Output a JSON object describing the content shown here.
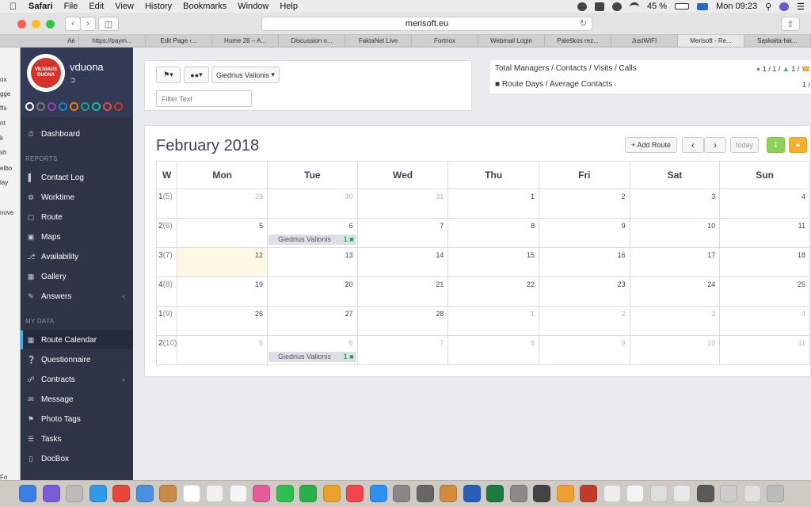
{
  "menubar": {
    "app": "Safari",
    "items": [
      "File",
      "Edit",
      "View",
      "History",
      "Bookmarks",
      "Window",
      "Help"
    ],
    "battery": "45 %",
    "clock": "Mon 09:23"
  },
  "browser": {
    "url": "merisoft.eu",
    "tabs": [
      "Aė",
      "https://paym...",
      "Edit Page ‹...",
      "Home 28 – A...",
      "Discussion o...",
      "FaktaNet Live",
      "Fortnox",
      "Webmail Login",
      "Paleškos rez...",
      "JustWIFI",
      "Merisoft - Re...",
      "Sąskaita-fak..."
    ],
    "active_tab": 10
  },
  "leftstrip": [
    "ox",
    "gge",
    "fts",
    "nt",
    "k",
    "sh",
    "elbo",
    "lay",
    "nove",
    "Fo"
  ],
  "sidebar": {
    "username": "vduona",
    "logo_text": "VILNIAUS DUONA",
    "swatches": [
      "#ffffff",
      "#7a7a7a",
      "#8e44ad",
      "#2980b9",
      "#e67e22",
      "#16a085",
      "#1abc9c",
      "#e74c3c",
      "#c0392b"
    ],
    "dashboard": "Dashboard",
    "section_reports": "REPORTS",
    "reports": [
      "Contact Log",
      "Worktime",
      "Route",
      "Maps",
      "Availability",
      "Gallery",
      "Answers"
    ],
    "section_mydata": "MY DATA",
    "mydata": [
      "Route Calendar",
      "Questionnaire",
      "Contracts",
      "Message",
      "Photo Tags",
      "Tasks",
      "DocBox"
    ]
  },
  "filters": {
    "user_select": "Giedrius Valionis",
    "filter_placeholder": "Filter Text"
  },
  "stats": {
    "row1_label": "Total Managers / Contacts / Visits / Calls",
    "row1_value_a": "1",
    "row1_value_b": "1",
    "row1_value_c": "1",
    "row2_label": "Route Days / Average Contacts",
    "row2_value": "1 /"
  },
  "calendar": {
    "title": "February 2018",
    "add_route": "+ Add Route",
    "today_label": "today",
    "week_header": "W",
    "days": [
      "Mon",
      "Tue",
      "Wed",
      "Thu",
      "Fri",
      "Sat",
      "Sun"
    ],
    "weeks": [
      {
        "w": "1",
        "sub": "(5)",
        "dates": [
          [
            "29",
            true
          ],
          [
            "30",
            true
          ],
          [
            "31",
            true
          ],
          [
            "1",
            false
          ],
          [
            "2",
            false
          ],
          [
            "3",
            false
          ],
          [
            "4",
            false
          ]
        ]
      },
      {
        "w": "2",
        "sub": "(6)",
        "dates": [
          [
            "5",
            false
          ],
          [
            "6",
            false
          ],
          [
            "7",
            false
          ],
          [
            "8",
            false
          ],
          [
            "9",
            false
          ],
          [
            "10",
            false
          ],
          [
            "11",
            false
          ]
        ]
      },
      {
        "w": "3",
        "sub": "(7)",
        "dates": [
          [
            "12",
            false
          ],
          [
            "13",
            false
          ],
          [
            "14",
            false
          ],
          [
            "15",
            false
          ],
          [
            "16",
            false
          ],
          [
            "17",
            false
          ],
          [
            "18",
            false
          ]
        ]
      },
      {
        "w": "4",
        "sub": "(8)",
        "dates": [
          [
            "19",
            false
          ],
          [
            "20",
            false
          ],
          [
            "21",
            false
          ],
          [
            "22",
            false
          ],
          [
            "23",
            false
          ],
          [
            "24",
            false
          ],
          [
            "25",
            false
          ]
        ]
      },
      {
        "w": "1",
        "sub": "(9)",
        "dates": [
          [
            "26",
            false
          ],
          [
            "27",
            false
          ],
          [
            "28",
            false
          ],
          [
            "1",
            true
          ],
          [
            "2",
            true
          ],
          [
            "3",
            true
          ],
          [
            "4",
            true
          ]
        ]
      },
      {
        "w": "2",
        "sub": "(10)",
        "dates": [
          [
            "5",
            true
          ],
          [
            "6",
            true
          ],
          [
            "7",
            true
          ],
          [
            "8",
            true
          ],
          [
            "9",
            true
          ],
          [
            "10",
            true
          ],
          [
            "11",
            true
          ]
        ]
      }
    ],
    "today_cell": [
      2,
      0
    ],
    "events": [
      {
        "week": 1,
        "day": 1,
        "label": "Giedrius Valionis",
        "count": "1"
      },
      {
        "week": 5,
        "day": 1,
        "label": "Giedrius Valionis",
        "count": "1"
      }
    ]
  },
  "dock_colors": [
    "#3d7fe0",
    "#7b5bd6",
    "#bbbbbb",
    "#2f9be8",
    "#e8453c",
    "#4a8fe0",
    "#c98b48",
    "#ffffff",
    "#f0f0f0",
    "#f5f5f5",
    "#e55b9c",
    "#2fbf4f",
    "#29b04a",
    "#e8a32c",
    "#f3454f",
    "#2d8ff0",
    "#888888",
    "#666666",
    "#d18b3b",
    "#2b5cb8",
    "#1f7a3f",
    "#8a8a8a",
    "#444444",
    "#f0a030",
    "#c23a2b",
    "#eeeeee",
    "#f4f4f4",
    "#dddddd",
    "#e9e9e9",
    "#5a5a5a",
    "#cccccc",
    "#e0e0e0",
    "#bbbbbb"
  ]
}
